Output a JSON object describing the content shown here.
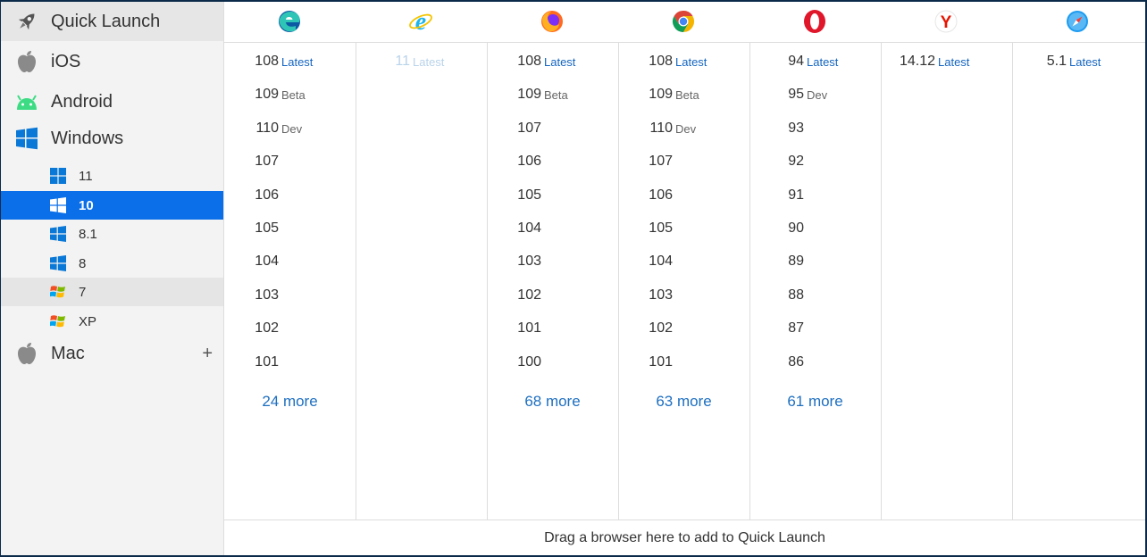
{
  "sidebar": {
    "quick_launch": "Quick Launch",
    "ios": "iOS",
    "android": "Android",
    "windows": "Windows",
    "windows_versions": [
      "11",
      "10",
      "8.1",
      "8",
      "7",
      "XP"
    ],
    "selected_windows": "10",
    "mac": "Mac",
    "mac_expand": "+"
  },
  "browsers": [
    {
      "icon": "edge-icon",
      "versions": [
        {
          "num": "108",
          "tag": "Latest"
        },
        {
          "num": "109",
          "tag": "Beta"
        },
        {
          "num": "110",
          "tag": "Dev"
        },
        {
          "num": "107",
          "tag": ""
        },
        {
          "num": "106",
          "tag": ""
        },
        {
          "num": "105",
          "tag": ""
        },
        {
          "num": "104",
          "tag": ""
        },
        {
          "num": "103",
          "tag": ""
        },
        {
          "num": "102",
          "tag": ""
        },
        {
          "num": "101",
          "tag": ""
        }
      ],
      "more": "24 more"
    },
    {
      "icon": "internet-explorer-icon",
      "versions": [
        {
          "num": "11",
          "tag": "Latest"
        }
      ],
      "more": ""
    },
    {
      "icon": "firefox-icon",
      "versions": [
        {
          "num": "108",
          "tag": "Latest"
        },
        {
          "num": "109",
          "tag": "Beta"
        },
        {
          "num": "107",
          "tag": ""
        },
        {
          "num": "106",
          "tag": ""
        },
        {
          "num": "105",
          "tag": ""
        },
        {
          "num": "104",
          "tag": ""
        },
        {
          "num": "103",
          "tag": ""
        },
        {
          "num": "102",
          "tag": ""
        },
        {
          "num": "101",
          "tag": ""
        },
        {
          "num": "100",
          "tag": ""
        }
      ],
      "more": "68 more"
    },
    {
      "icon": "chrome-icon",
      "versions": [
        {
          "num": "108",
          "tag": "Latest"
        },
        {
          "num": "109",
          "tag": "Beta"
        },
        {
          "num": "110",
          "tag": "Dev"
        },
        {
          "num": "107",
          "tag": ""
        },
        {
          "num": "106",
          "tag": ""
        },
        {
          "num": "105",
          "tag": ""
        },
        {
          "num": "104",
          "tag": ""
        },
        {
          "num": "103",
          "tag": ""
        },
        {
          "num": "102",
          "tag": ""
        },
        {
          "num": "101",
          "tag": ""
        }
      ],
      "more": "63 more"
    },
    {
      "icon": "opera-icon",
      "versions": [
        {
          "num": "94",
          "tag": "Latest"
        },
        {
          "num": "95",
          "tag": "Dev"
        },
        {
          "num": "93",
          "tag": ""
        },
        {
          "num": "92",
          "tag": ""
        },
        {
          "num": "91",
          "tag": ""
        },
        {
          "num": "90",
          "tag": ""
        },
        {
          "num": "89",
          "tag": ""
        },
        {
          "num": "88",
          "tag": ""
        },
        {
          "num": "87",
          "tag": ""
        },
        {
          "num": "86",
          "tag": ""
        }
      ],
      "more": "61 more"
    },
    {
      "icon": "yandex-icon",
      "versions": [
        {
          "num": "14.12",
          "tag": "Latest"
        }
      ],
      "more": ""
    },
    {
      "icon": "safari-icon",
      "versions": [
        {
          "num": "5.1",
          "tag": "Latest"
        }
      ],
      "more": ""
    }
  ],
  "footer": "Drag a browser here to add to Quick Launch",
  "colors": {
    "accent": "#0a6fe8",
    "link": "#1e6fc0"
  }
}
